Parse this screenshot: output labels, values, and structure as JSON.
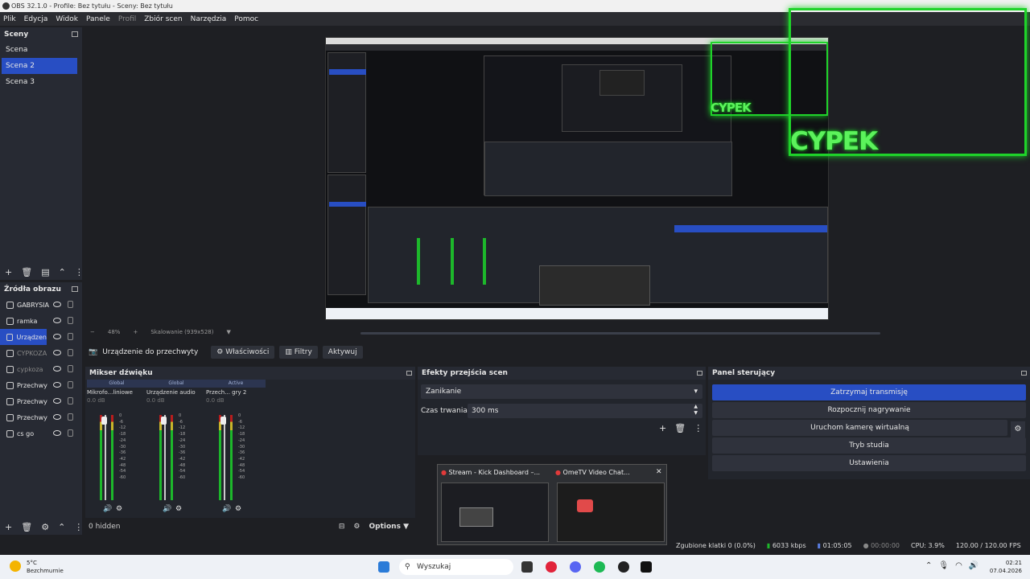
{
  "window": {
    "title": "OBS 32.1.0 - Profile: Bez tytułu - Sceny: Bez tytułu"
  },
  "menu": {
    "items": [
      "Plik",
      "Edycja",
      "Widok",
      "Panele",
      "Profil",
      "Zbiór scen",
      "Narzędzia",
      "Pomoc"
    ]
  },
  "scenes": {
    "title": "Sceny",
    "items": [
      "Scena",
      "Scena 2",
      "Scena 3"
    ]
  },
  "sources": {
    "title": "Źródła obrazu",
    "items": [
      "GABRYSIA",
      "ramka",
      "Urządzen",
      "CYPKOZA",
      "cypkoza",
      "Przechwy",
      "Przechwy",
      "Przechwy",
      "cs go"
    ],
    "hidden_label": "0 hidden"
  },
  "preview": {
    "zoom": "48%",
    "scaling": "Skalowanie (939x528)",
    "overlay_text": "CYPEK"
  },
  "properties_bar": {
    "device": "Urządzenie do przechwyty",
    "properties": "Właściwości",
    "filters": "Filtry",
    "activate": "Aktywuj"
  },
  "mixer": {
    "title": "Mikser dźwięku",
    "channels": [
      {
        "tag": "Global",
        "name": "Mikrofo...liniowe",
        "db": "0.0 dB"
      },
      {
        "tag": "Global",
        "name": "Urządzenie audio",
        "db": "0.0 dB"
      },
      {
        "tag": "Active",
        "name": "Przech... gry 2",
        "db": "0.0 dB"
      }
    ],
    "scale": [
      "0",
      "-6",
      "-12",
      "-18",
      "-24",
      "-30",
      "-36",
      "-42",
      "-48",
      "-54",
      "-60"
    ],
    "options_label": "Options"
  },
  "transitions": {
    "title": "Efekty przejścia scen",
    "selected": "Zanikanie",
    "duration_label": "Czas trwania",
    "duration_value": "300 ms"
  },
  "controls": {
    "title": "Panel sterujący",
    "buttons": [
      "Zatrzymaj transmisję",
      "Rozpocznij nagrywanie",
      "Uruchom kamerę wirtualną",
      "Tryb studia",
      "Ustawienia"
    ]
  },
  "popup": {
    "items": [
      "Stream - Kick Dashboard –...",
      "OmeTV Video Chat..."
    ]
  },
  "status": {
    "dropped": "Zgubione klatki 0 (0.0%)",
    "bitrate": "6033 kbps",
    "stream_time": "01:05:05",
    "rec_time": "00:00:00",
    "cpu": "CPU: 3.9%",
    "fps": "120.00 / 120.00 FPS"
  },
  "taskbar": {
    "weather_temp": "5°C",
    "weather_desc": "Bezchmurnie",
    "search": "Wyszukaj",
    "time": "02:21",
    "date": "07.04.2026"
  },
  "colors": {
    "accent": "#284ec3",
    "neon": "#1fd32a"
  }
}
